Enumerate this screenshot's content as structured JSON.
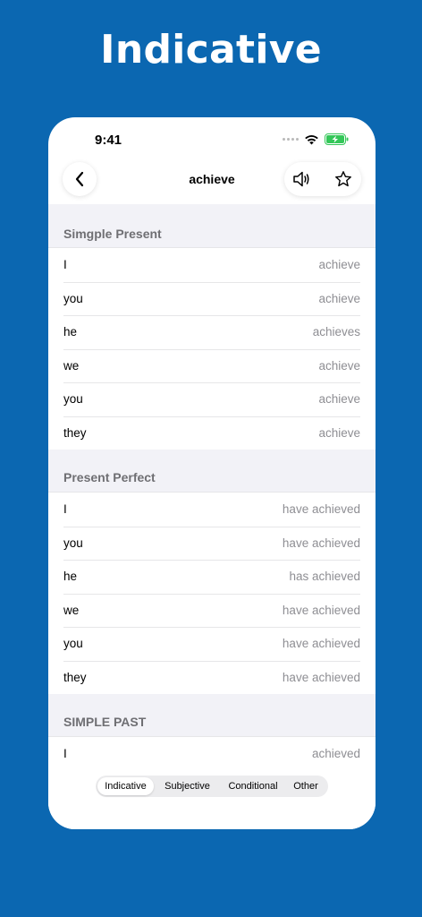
{
  "hero": {
    "title": "Indicative"
  },
  "status_bar": {
    "time": "9:41"
  },
  "nav": {
    "title": "achieve"
  },
  "sections": [
    {
      "title": "Simgple Present",
      "rows": [
        {
          "pronoun": "I",
          "verb": "achieve"
        },
        {
          "pronoun": "you",
          "verb": "achieve"
        },
        {
          "pronoun": "he",
          "verb": "achieves"
        },
        {
          "pronoun": "we",
          "verb": "achieve"
        },
        {
          "pronoun": "you",
          "verb": "achieve"
        },
        {
          "pronoun": "they",
          "verb": "achieve"
        }
      ]
    },
    {
      "title": "Present Perfect",
      "rows": [
        {
          "pronoun": "I",
          "verb": "have achieved"
        },
        {
          "pronoun": "you",
          "verb": "have achieved"
        },
        {
          "pronoun": "he",
          "verb": "has achieved"
        },
        {
          "pronoun": "we",
          "verb": "have achieved"
        },
        {
          "pronoun": "you",
          "verb": "have achieved"
        },
        {
          "pronoun": "they",
          "verb": "have achieved"
        }
      ]
    },
    {
      "title": "SIMPLE PAST",
      "rows": [
        {
          "pronoun": "I",
          "verb": "achieved"
        }
      ]
    }
  ],
  "mood_tabs": [
    {
      "label": "Indicative",
      "selected": true
    },
    {
      "label": "Subjective",
      "selected": false
    },
    {
      "label": "Conditional",
      "selected": false
    },
    {
      "label": "Other",
      "selected": false
    }
  ],
  "icons": {
    "back": "chevron-left-icon",
    "speaker": "speaker-icon",
    "favorite": "star-outline-icon",
    "wifi": "wifi-icon",
    "battery": "battery-charging-icon"
  },
  "colors": {
    "background": "#0b67b1",
    "battery": "#34c759",
    "secondary_text": "#8e8e93"
  }
}
